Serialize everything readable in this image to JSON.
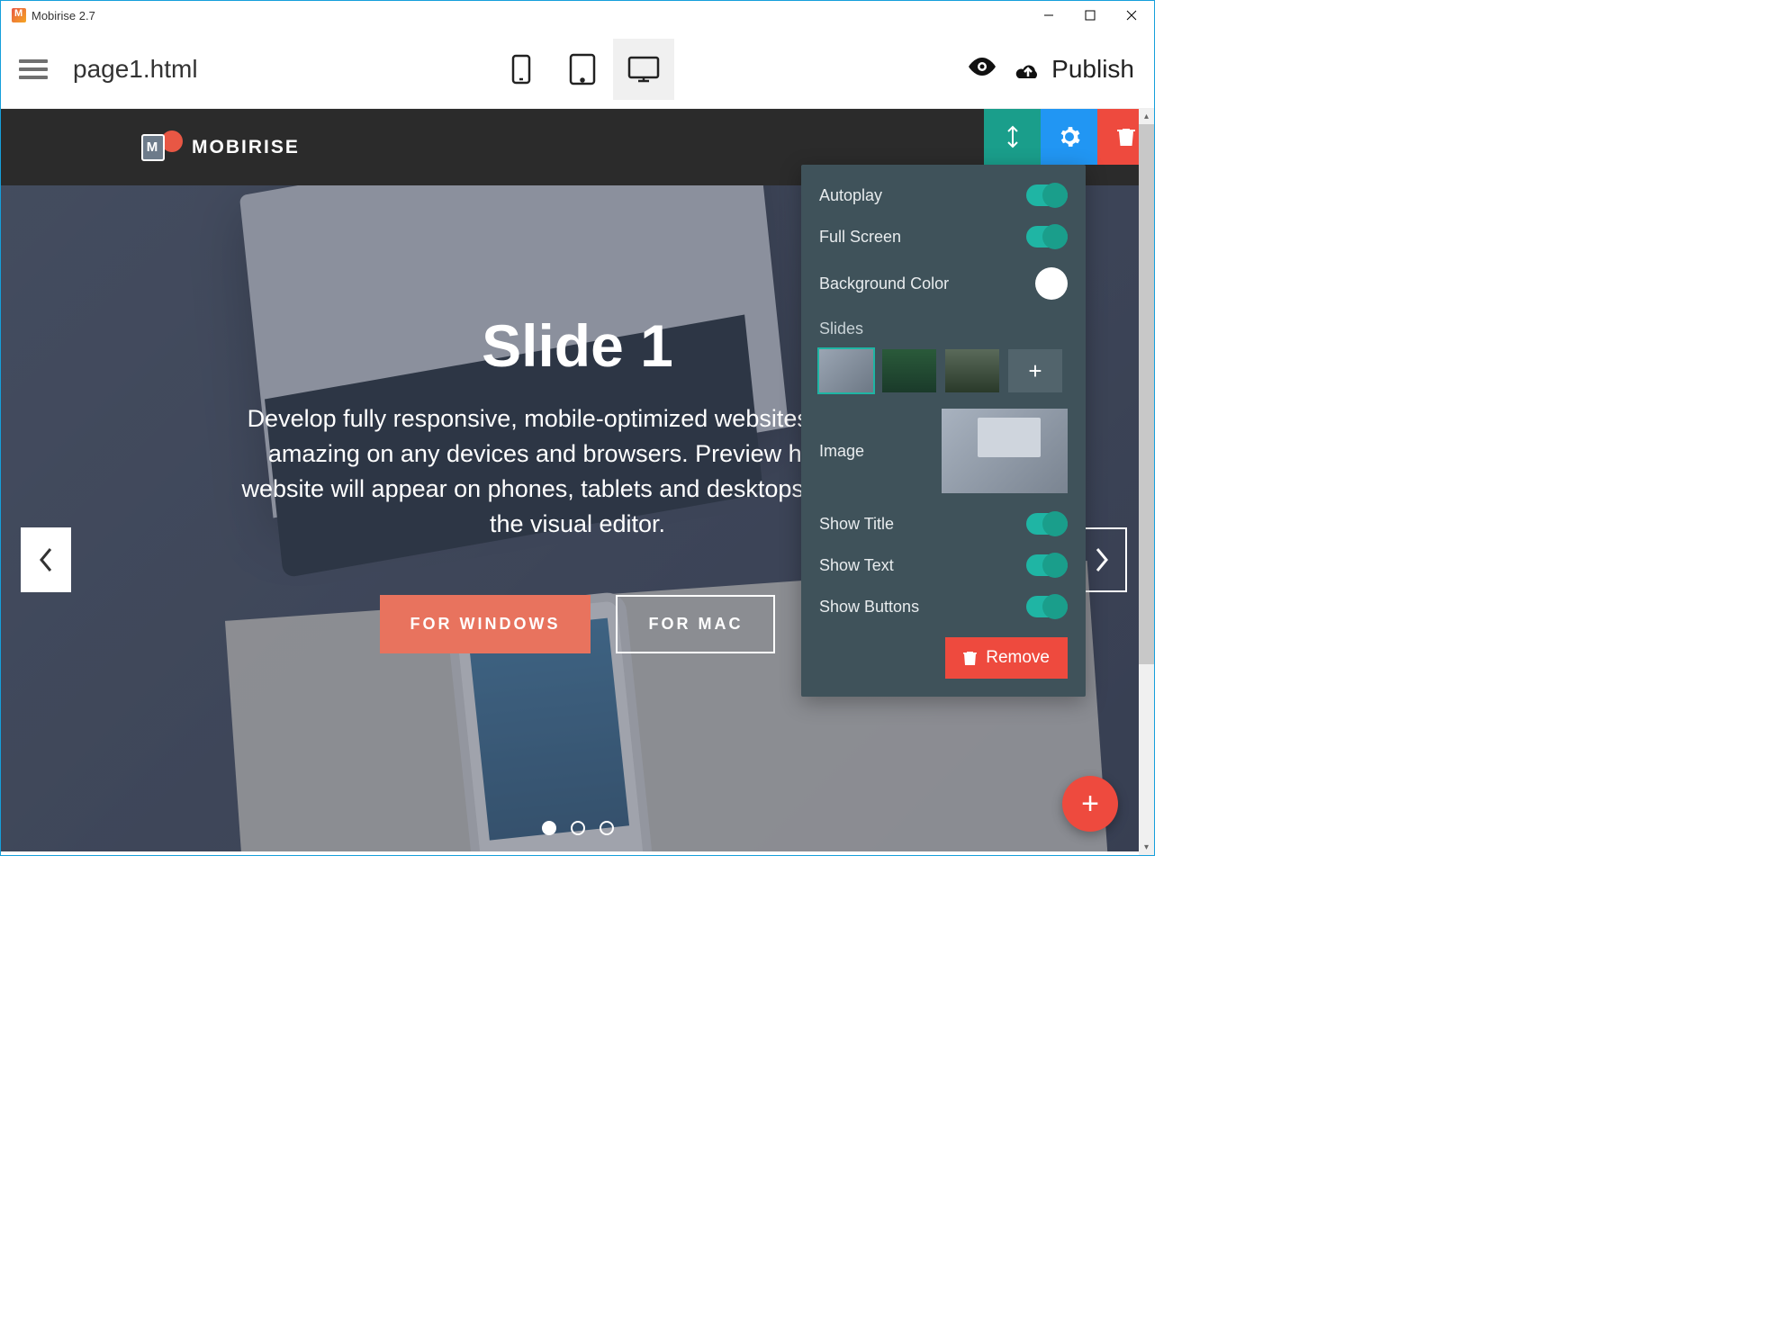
{
  "window": {
    "title": "Mobirise 2.7"
  },
  "toolbar": {
    "page_name": "page1.html",
    "publish_label": "Publish"
  },
  "site_header": {
    "brand": "MOBIRISE"
  },
  "hero": {
    "title": "Slide 1",
    "text": "Develop fully responsive, mobile-optimized websites that look amazing on any devices and browsers. Preview how your website will appear on phones, tablets and desktops directly in the visual editor.",
    "btn_windows": "FOR WINDOWS",
    "btn_mac": "FOR MAC"
  },
  "panel": {
    "autoplay": "Autoplay",
    "fullscreen": "Full Screen",
    "bgcolor": "Background Color",
    "slides": "Slides",
    "image": "Image",
    "show_title": "Show Title",
    "show_text": "Show Text",
    "show_buttons": "Show Buttons",
    "remove": "Remove",
    "color_value": "#ffffff",
    "toggles": {
      "autoplay": true,
      "fullscreen": true,
      "show_title": true,
      "show_text": true,
      "show_buttons": true
    },
    "slide_count": 3,
    "selected_slide": 0
  }
}
